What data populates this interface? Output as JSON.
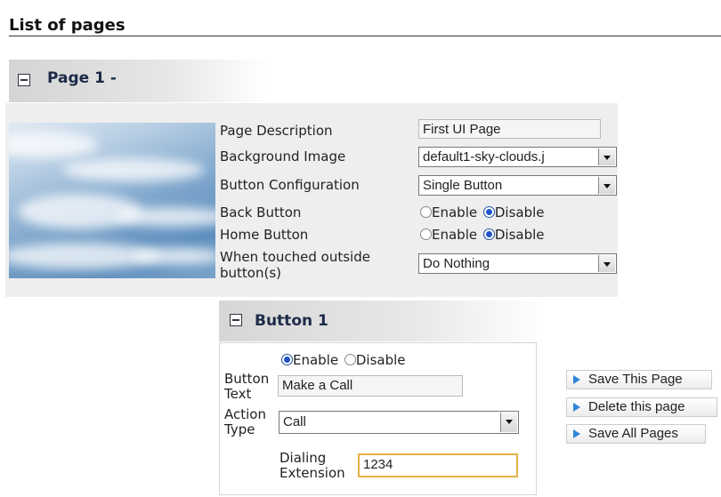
{
  "section_title": "List of pages",
  "page": {
    "title": "Page 1 -",
    "fields": {
      "description_label": "Page Description",
      "description_value": "First UI Page",
      "background_label": "Background Image",
      "background_value": "default1-sky-clouds.j",
      "button_config_label": "Button Configuration",
      "button_config_value": "Single Button",
      "back_button_label": "Back Button",
      "home_button_label": "Home Button",
      "touched_outside_label": "When touched outside button(s)",
      "touched_outside_value": "Do Nothing",
      "enable_label": "Enable",
      "disable_label": "Disable"
    }
  },
  "button": {
    "title": "Button 1",
    "enable_label": "Enable",
    "disable_label": "Disable",
    "text_label": "Button Text",
    "text_value": "Make a Call",
    "action_label": "Action Type",
    "action_value": "Call",
    "extension_label": "Dialing Extension",
    "extension_value": "1234"
  },
  "actions": {
    "save_page": "Save This Page",
    "delete_page": "Delete this page",
    "save_all": "Save All Pages"
  },
  "icons": {
    "collapse": "minus-box-icon",
    "dropdown": "chevron-down-icon",
    "action": "play-arrow-icon"
  }
}
